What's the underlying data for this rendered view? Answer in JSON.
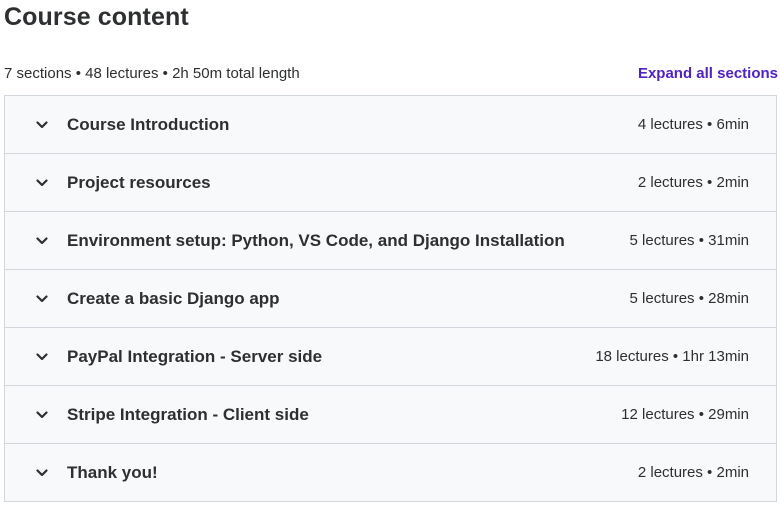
{
  "header": {
    "title": "Course content",
    "summary": "7 sections • 48 lectures • 2h 50m total length",
    "expand_all_label": "Expand all sections"
  },
  "colors": {
    "accent": "#5022c3",
    "text": "#2d2f31",
    "section_bg": "#f7f9fa",
    "border": "#d1d7dc"
  },
  "sections": [
    {
      "title": "Course Introduction",
      "meta": "4 lectures • 6min",
      "icon": "chevron-down-icon"
    },
    {
      "title": "Project resources",
      "meta": "2 lectures • 2min",
      "icon": "chevron-down-icon"
    },
    {
      "title": "Environment setup: Python, VS Code, and Django Installation",
      "meta": "5 lectures • 31min",
      "icon": "chevron-down-icon"
    },
    {
      "title": "Create a basic Django app",
      "meta": "5 lectures • 28min",
      "icon": "chevron-down-icon"
    },
    {
      "title": "PayPal Integration - Server side",
      "meta": "18 lectures • 1hr 13min",
      "icon": "chevron-down-icon"
    },
    {
      "title": "Stripe Integration - Client side",
      "meta": "12 lectures • 29min",
      "icon": "chevron-down-icon"
    },
    {
      "title": "Thank you!",
      "meta": "2 lectures • 2min",
      "icon": "chevron-down-icon"
    }
  ]
}
